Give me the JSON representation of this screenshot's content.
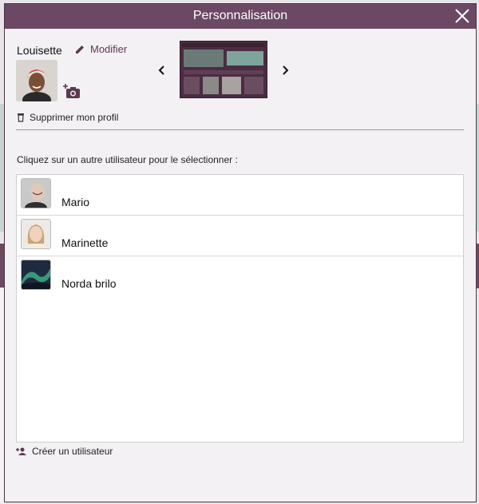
{
  "modal": {
    "title": "Personnalisation"
  },
  "profile": {
    "username": "Louisette",
    "modify_label": "Modifier",
    "delete_label": "Supprimer mon profil"
  },
  "instruction": "Cliquez sur un autre utilisateur pour le sélectionner :",
  "users": [
    {
      "name": "Mario"
    },
    {
      "name": "Marinette"
    },
    {
      "name": "Norda brilo"
    }
  ],
  "create_label": "Créer un utilisateur",
  "colors": {
    "header": "#6b4863",
    "accent": "#5a3a50",
    "background": "#f4f1f4"
  },
  "icons": [
    "close-icon",
    "pencil-icon",
    "add-photo-icon",
    "chevron-left-icon",
    "chevron-right-icon",
    "trash-icon",
    "add-user-icon"
  ]
}
